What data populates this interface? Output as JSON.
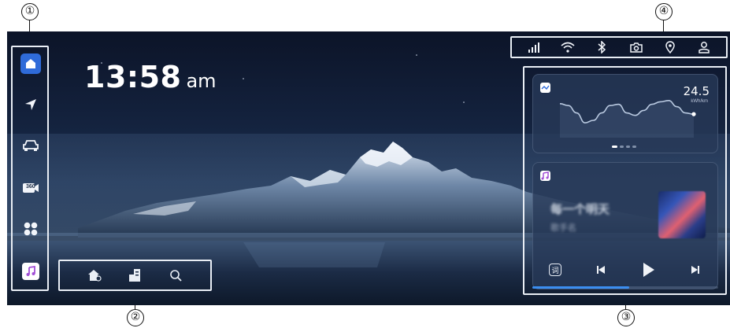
{
  "clock": {
    "time": "13:58",
    "ampm": "am"
  },
  "callouts": {
    "c1": "①",
    "c2": "②",
    "c3": "③",
    "c4": "④"
  },
  "sidebar": {
    "items": [
      {
        "icon": "home-icon",
        "active": true
      },
      {
        "icon": "navigation-arrow-icon"
      },
      {
        "icon": "car-icon"
      },
      {
        "icon": "camera-360-icon",
        "label": "360"
      },
      {
        "icon": "apps-grid-icon"
      },
      {
        "icon": "music-note-icon"
      }
    ]
  },
  "quickbar": {
    "items": [
      {
        "icon": "home-settings-icon"
      },
      {
        "icon": "building-icon"
      },
      {
        "icon": "search-icon"
      }
    ]
  },
  "statusbar": {
    "items": [
      {
        "icon": "signal-icon"
      },
      {
        "icon": "wifi-icon"
      },
      {
        "icon": "bluetooth-icon"
      },
      {
        "icon": "camera-icon"
      },
      {
        "icon": "location-pin-icon"
      },
      {
        "icon": "user-icon"
      }
    ]
  },
  "energy_card": {
    "value": "24.5",
    "unit": "kWh/km",
    "chart_data": {
      "type": "line",
      "series": [
        {
          "values": [
            55,
            52,
            40,
            24,
            28,
            40,
            52,
            54,
            40,
            36,
            44,
            54,
            58,
            60,
            50,
            40,
            38
          ]
        }
      ]
    }
  },
  "music_card": {
    "title": "每一个明天",
    "artist": "歌手名",
    "progress": 0.52,
    "lyric_label": "词"
  },
  "colors": {
    "accent": "#2f6bd9",
    "progress": "#3b8ef0",
    "music_tile_note": "#a14fd6"
  }
}
